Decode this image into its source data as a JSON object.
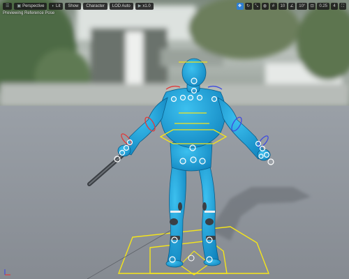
{
  "toolbar": {
    "menu_icon": "hamburger-icon",
    "perspective_label": "Perspective",
    "lit_label": "Lit",
    "show_label": "Show",
    "character_label": "Character",
    "lod_label": "LOD Auto",
    "speed_label": "x1.0"
  },
  "viewport": {
    "mode_label": "Previewing Reference Pose"
  },
  "right_tools": [
    {
      "icon": "translate-icon",
      "label": "✥",
      "active": true
    },
    {
      "icon": "rotate-icon",
      "label": "↻",
      "active": false
    },
    {
      "icon": "scale-icon",
      "label": "⤡",
      "active": false
    },
    {
      "icon": "globe-icon",
      "label": "◍",
      "active": false
    },
    {
      "icon": "grid-snap-icon",
      "label": "#",
      "active": false
    },
    {
      "icon": "grid-size",
      "label": "10",
      "active": false
    },
    {
      "icon": "angle-snap-icon",
      "label": "∠",
      "active": false
    },
    {
      "icon": "angle-size",
      "label": "10°",
      "active": false
    },
    {
      "icon": "scale-snap-icon",
      "label": "⊡",
      "active": false
    },
    {
      "icon": "scale-size",
      "label": "0.25",
      "active": false
    },
    {
      "icon": "camera-speed-icon",
      "label": "4",
      "active": false
    },
    {
      "icon": "maximize-icon",
      "label": "⛶",
      "active": false
    }
  ],
  "colors": {
    "mannequin": "#1a9fd6",
    "mannequin_dark": "#0a6ea0",
    "floor": "#8b8f96",
    "sky": "#a9b4b0",
    "control_yellow": "#f5e51a",
    "control_red": "#e03a3a",
    "control_blue": "#3f4be0",
    "joint_white": "#ffffff"
  }
}
